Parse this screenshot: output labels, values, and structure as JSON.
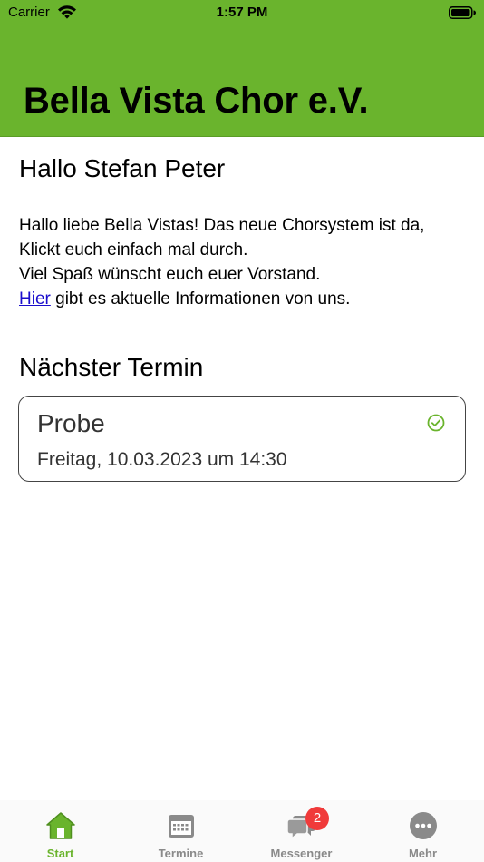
{
  "status_bar": {
    "carrier": "Carrier",
    "time": "1:57 PM"
  },
  "header": {
    "title": "Bella Vista Chor e.V."
  },
  "greeting": "Hallo Stefan Peter",
  "message": {
    "line1": "Hallo liebe Bella Vistas! Das neue Chorsystem ist da,",
    "line2": "Klickt euch einfach mal durch.",
    "line3": "Viel Spaß wünscht euch euer Vorstand.",
    "link_text": "Hier",
    "line4_rest": " gibt es  aktuelle Informationen von uns."
  },
  "next_event": {
    "section_title": "Nächster Termin",
    "title": "Probe",
    "date": "Freitag, 10.03.2023 um 14:30"
  },
  "tabs": [
    {
      "label": "Start",
      "icon": "home-icon",
      "active": true
    },
    {
      "label": "Termine",
      "icon": "calendar-icon",
      "active": false
    },
    {
      "label": "Messenger",
      "icon": "chat-bubbles-icon",
      "active": false,
      "badge": "2"
    },
    {
      "label": "Mehr",
      "icon": "more-icon",
      "active": false
    }
  ],
  "colors": {
    "accent": "#6ab42d",
    "badge": "#f03a3a",
    "inactive": "#8a8a8a"
  }
}
